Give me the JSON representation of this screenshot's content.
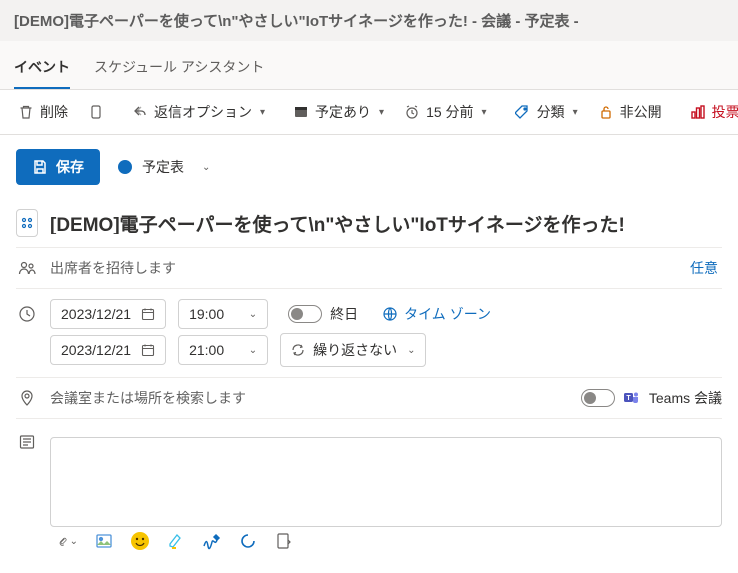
{
  "window_title": "[DEMO]電子ペーパーを使って\\n\"やさしい\"IoTサイネージを作った! - 会議 - 予定表 - ",
  "tabs": {
    "event": "イベント",
    "scheduling": "スケジュール アシスタント"
  },
  "toolbar": {
    "delete": "削除",
    "reply_options": "返信オプション",
    "busy": "予定あり",
    "reminder": "15 分前",
    "categorize": "分類",
    "private": "非公開",
    "poll": "投票"
  },
  "save": {
    "label": "保存",
    "calendar_name": "予定表"
  },
  "subject": "[DEMO]電子ペーパーを使って\\n\"やさしい\"IoTサイネージを作った!",
  "attendees": {
    "placeholder": "出席者を招待します",
    "optional": "任意"
  },
  "datetime": {
    "start_date": "2023/12/21",
    "start_time": "19:00",
    "end_date": "2023/12/21",
    "end_time": "21:00",
    "allday_label": "終日",
    "timezone_label": "タイム ゾーン",
    "repeat_label": "繰り返さない"
  },
  "location": {
    "placeholder": "会議室または場所を検索します",
    "teams_label": "Teams 会議"
  }
}
